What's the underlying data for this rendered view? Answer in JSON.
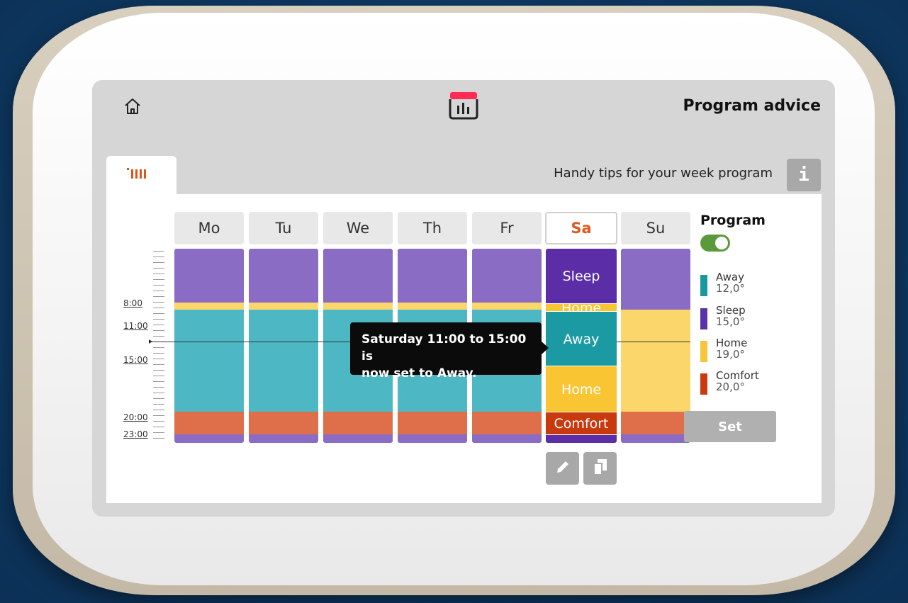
{
  "header": {
    "title": "Program advice",
    "home_icon": "home-icon",
    "calendar_icon": "calendar-program-icon",
    "accent_color": "#ff2d55"
  },
  "tab_bar": {
    "active_tab_icon": "radiator-icon",
    "tips_text": "Handy tips for your week program",
    "info_label": "i"
  },
  "time_axis": {
    "labels": [
      "8:00",
      "11:00",
      "15:00",
      "20:00",
      "23:00"
    ]
  },
  "days": [
    {
      "label": "Mo",
      "selected": false
    },
    {
      "label": "Tu",
      "selected": false
    },
    {
      "label": "We",
      "selected": false
    },
    {
      "label": "Th",
      "selected": false
    },
    {
      "label": "Fr",
      "selected": false
    },
    {
      "label": "Sa",
      "selected": true
    },
    {
      "label": "Su",
      "selected": false
    }
  ],
  "schedule": {
    "weekday": [
      {
        "mode": "Sleep",
        "start": "0:00",
        "end": "7:30"
      },
      {
        "mode": "Home",
        "start": "7:30",
        "end": "8:00"
      },
      {
        "mode": "Away",
        "start": "8:00",
        "end": "20:00"
      },
      {
        "mode": "Comfort",
        "start": "20:00",
        "end": "23:00"
      },
      {
        "mode": "Sleep",
        "start": "23:00",
        "end": "24:00"
      }
    ],
    "saturday": [
      {
        "mode": "Sleep",
        "start": "0:00",
        "end": "8:00",
        "label": "Sleep"
      },
      {
        "mode": "Home",
        "start": "8:00",
        "end": "11:00",
        "label": "Home"
      },
      {
        "mode": "Away",
        "start": "11:00",
        "end": "15:00",
        "label": "Away"
      },
      {
        "mode": "Home",
        "start": "15:00",
        "end": "20:00",
        "label": "Home"
      },
      {
        "mode": "Comfort",
        "start": "20:00",
        "end": "23:00",
        "label": "Comfort"
      },
      {
        "mode": "Sleep",
        "start": "23:00",
        "end": "24:00",
        "label": ""
      }
    ],
    "sunday": [
      {
        "mode": "Sleep",
        "start": "0:00",
        "end": "8:00"
      },
      {
        "mode": "Home",
        "start": "8:00",
        "end": "20:00"
      },
      {
        "mode": "Comfort",
        "start": "20:00",
        "end": "23:00"
      },
      {
        "mode": "Sleep",
        "start": "23:00",
        "end": "24:00"
      }
    ]
  },
  "tooltip": {
    "line1": "Saturday 11:00 to 15:00 is",
    "line2": "now set to Away."
  },
  "program": {
    "label": "Program",
    "enabled": true
  },
  "legend": [
    {
      "name": "Away",
      "temp": "12,0°",
      "color": "#1b97a0"
    },
    {
      "name": "Sleep",
      "temp": "15,0°",
      "color": "#5b33a8"
    },
    {
      "name": "Home",
      "temp": "19,0°",
      "color": "#f7c43a"
    },
    {
      "name": "Comfort",
      "temp": "20,0°",
      "color": "#c93a0e"
    }
  ],
  "colors": {
    "muted": {
      "Sleep": "#8a6cc4",
      "Home": "#fbd76b",
      "Away": "#4db7c3",
      "Comfort": "#df6f4b"
    },
    "bold": {
      "Sleep": "#5b2ea8",
      "Home": "#f9c533",
      "Away": "#1c9aa3",
      "Comfort": "#c9390e"
    }
  },
  "buttons": {
    "set_label": "Set",
    "edit_icon": "pencil-icon",
    "copy_icon": "copy-icon"
  }
}
